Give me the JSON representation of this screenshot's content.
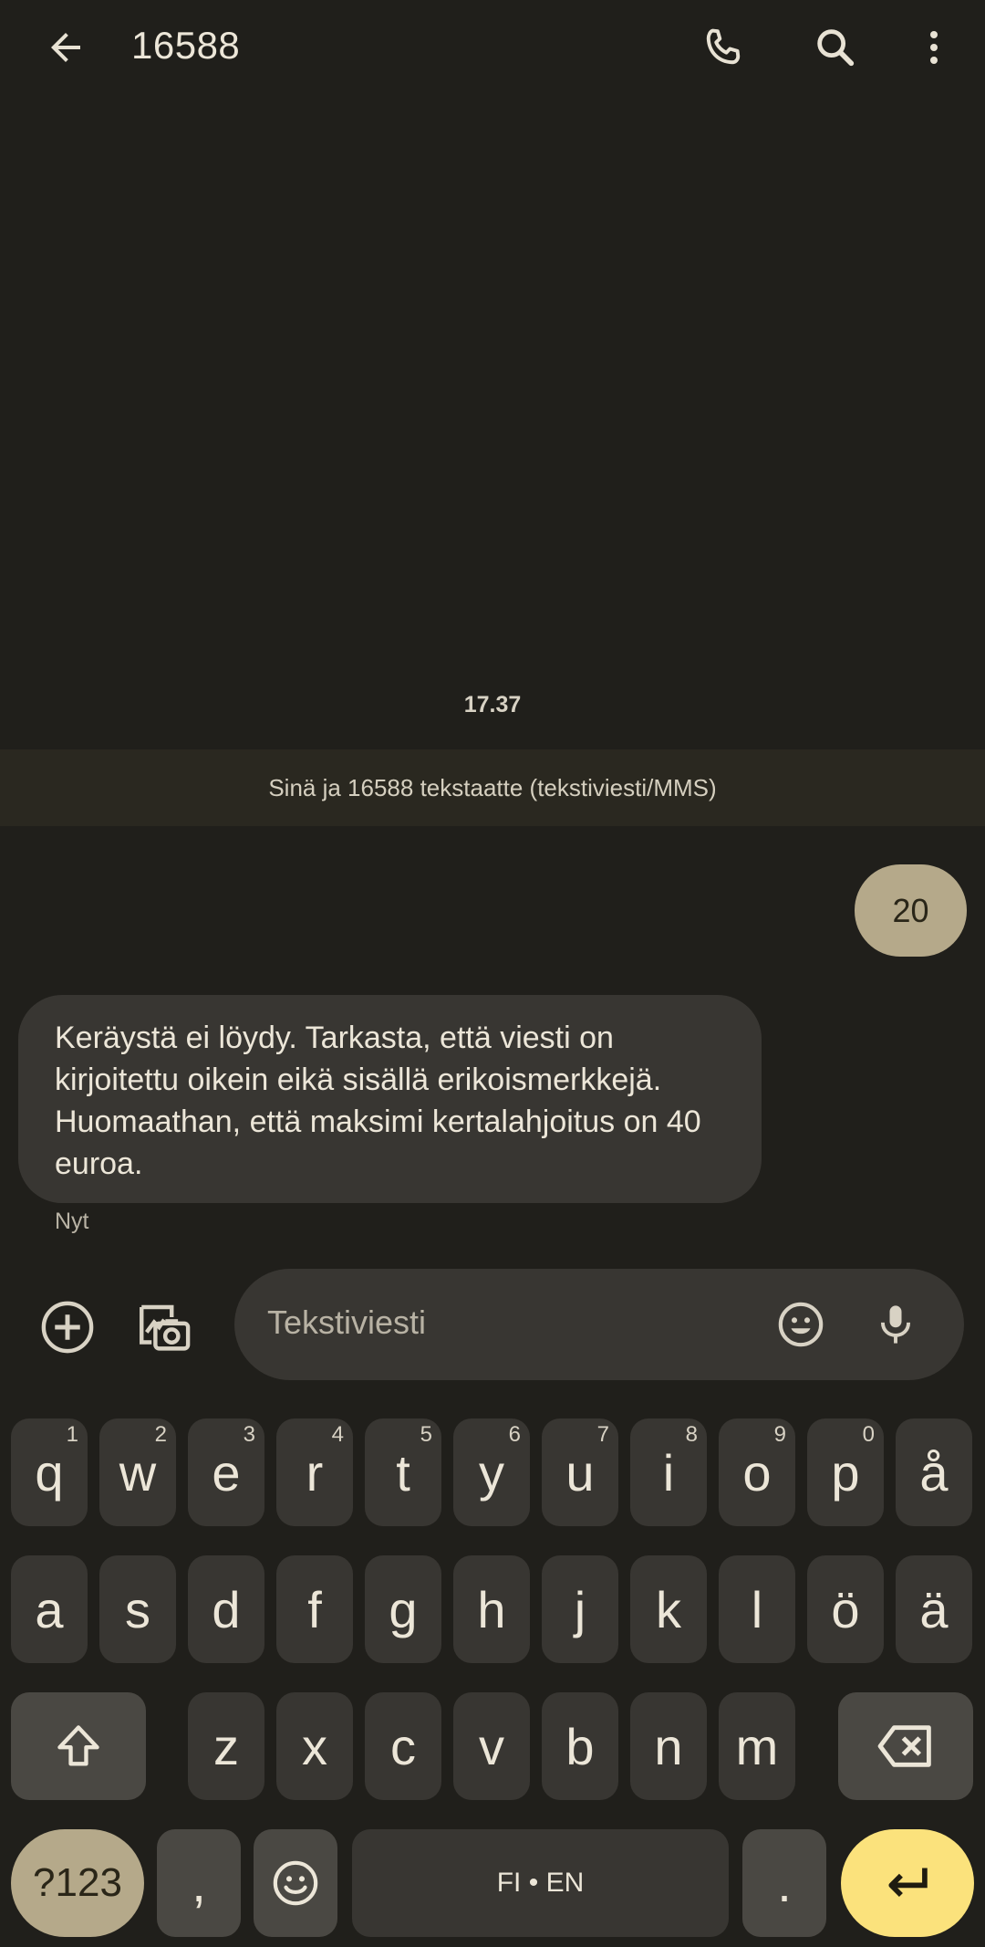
{
  "appbar": {
    "title": "16588"
  },
  "conversation": {
    "timestamp": "17.37",
    "banner": "Sinä ja 16588 tekstaatte (tekstiviesti/MMS)",
    "outgoing": "20",
    "incoming": "Keräystä ei löydy. Tarkasta, että viesti on kirjoitettu oikein eikä sisällä erikoismerkkejä. Huomaathan, että maksimi kertalahjoitus on 40 euroa.",
    "incoming_time": "Nyt"
  },
  "compose": {
    "placeholder": "Tekstiviesti"
  },
  "keyboard": {
    "row1": [
      {
        "k": "q",
        "h": "1"
      },
      {
        "k": "w",
        "h": "2"
      },
      {
        "k": "e",
        "h": "3"
      },
      {
        "k": "r",
        "h": "4"
      },
      {
        "k": "t",
        "h": "5"
      },
      {
        "k": "y",
        "h": "6"
      },
      {
        "k": "u",
        "h": "7"
      },
      {
        "k": "i",
        "h": "8"
      },
      {
        "k": "o",
        "h": "9"
      },
      {
        "k": "p",
        "h": "0"
      },
      {
        "k": "å",
        "h": ""
      }
    ],
    "row2": [
      "a",
      "s",
      "d",
      "f",
      "g",
      "h",
      "j",
      "k",
      "l",
      "ö",
      "ä"
    ],
    "row3": [
      "z",
      "x",
      "c",
      "v",
      "b",
      "n",
      "m"
    ],
    "mode_key": "?123",
    "comma_key": ",",
    "space_key": "FI • EN",
    "period_key": "."
  },
  "colors": {
    "background": "#201f1b",
    "bubble_out": "#b5a98a",
    "bubble_in": "#383632",
    "enter_key": "#fbe27c"
  }
}
